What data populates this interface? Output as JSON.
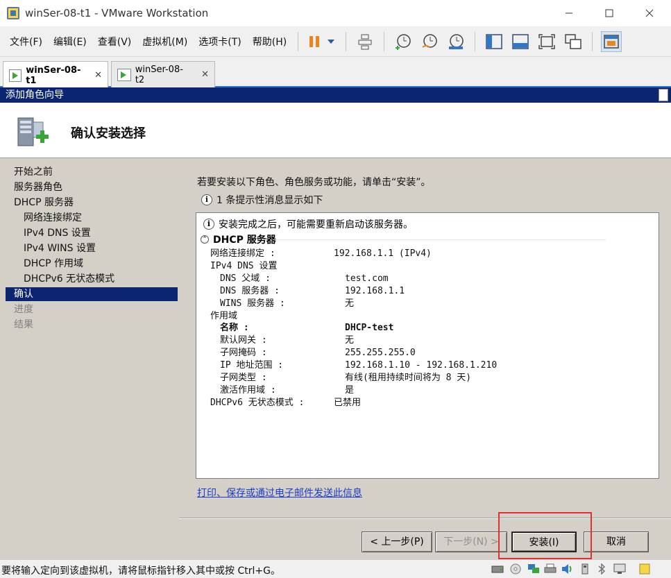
{
  "window": {
    "title": "winSer-08-t1 - VMware Workstation",
    "minimize_icon": "minimize-icon",
    "maximize_icon": "maximize-icon",
    "close_icon": "close-icon"
  },
  "menu": {
    "items": [
      "文件(F)",
      "编辑(E)",
      "查看(V)",
      "虚拟机(M)",
      "选项卡(T)",
      "帮助(H)"
    ]
  },
  "toolbar": {
    "icons": [
      "pause-icon",
      "dropdown-arrow-icon",
      "send-ctrl-alt-del-icon",
      "snapshot-take-icon",
      "snapshot-revert-icon",
      "snapshot-manager-icon",
      "library-view-icon",
      "console-view-icon",
      "fullscreen-icon",
      "unity-icon",
      "thumbnail-view-icon"
    ]
  },
  "tabs": [
    {
      "label": "winSer-08-t1",
      "active": true
    },
    {
      "label": "winSer-08-t2",
      "active": false
    }
  ],
  "wizard": {
    "title": "添加角色向导",
    "heading": "确认安装选择",
    "nav": [
      {
        "label": "开始之前",
        "level": 0,
        "state": "normal"
      },
      {
        "label": "服务器角色",
        "level": 0,
        "state": "normal"
      },
      {
        "label": "DHCP 服务器",
        "level": 0,
        "state": "normal"
      },
      {
        "label": "网络连接绑定",
        "level": 1,
        "state": "normal"
      },
      {
        "label": "IPv4 DNS 设置",
        "level": 1,
        "state": "normal"
      },
      {
        "label": "IPv4 WINS 设置",
        "level": 1,
        "state": "normal"
      },
      {
        "label": "DHCP 作用域",
        "level": 1,
        "state": "normal"
      },
      {
        "label": "DHCPv6 无状态模式",
        "level": 1,
        "state": "normal"
      },
      {
        "label": "确认",
        "level": 0,
        "state": "selected"
      },
      {
        "label": "进度",
        "level": 0,
        "state": "disabled"
      },
      {
        "label": "结果",
        "level": 0,
        "state": "disabled"
      }
    ],
    "intro": "若要安装以下角色、角色服务或功能，请单击“安装”。",
    "hint": "1 条提示性消息显示如下",
    "summary": {
      "restart_note": "安装完成之后，可能需要重新启动该服务器。",
      "section_title": "DHCP 服务器",
      "rows": [
        {
          "label": "网络连接绑定 :",
          "value": "192.168.1.1 (IPv4)",
          "indent": 0,
          "bold": false
        },
        {
          "label": "IPv4 DNS 设置",
          "value": "",
          "indent": 0,
          "bold": false
        },
        {
          "label": "DNS 父域 :",
          "value": "test.com",
          "indent": 1,
          "bold": false
        },
        {
          "label": "DNS 服务器 :",
          "value": "192.168.1.1",
          "indent": 1,
          "bold": false
        },
        {
          "label": "WINS 服务器 :",
          "value": "无",
          "indent": 1,
          "bold": false
        },
        {
          "label": "作用域",
          "value": "",
          "indent": 0,
          "bold": false
        },
        {
          "label": "名称 :",
          "value": "DHCP-test",
          "indent": 1,
          "bold": true
        },
        {
          "label": "默认网关 :",
          "value": "无",
          "indent": 1,
          "bold": false
        },
        {
          "label": "子网掩码 :",
          "value": "255.255.255.0",
          "indent": 1,
          "bold": false
        },
        {
          "label": "IP 地址范围 :",
          "value": "192.168.1.10 - 192.168.1.210",
          "indent": 1,
          "bold": false
        },
        {
          "label": "子网类型 :",
          "value": "有线(租用持续时间将为 8 天)",
          "indent": 1,
          "bold": false
        },
        {
          "label": "激活作用域 :",
          "value": "是",
          "indent": 1,
          "bold": false
        },
        {
          "label": "DHCPv6 无状态模式 :",
          "value": "已禁用",
          "indent": 0,
          "bold": false
        }
      ]
    },
    "link": "打印、保存或通过电子邮件发送此信息",
    "buttons": {
      "prev": "< 上一步(P)",
      "next": "下一步(N) >",
      "install": "安装(I)",
      "cancel": "取消"
    }
  },
  "statusbar": {
    "text": "要将输入定向到该虚拟机，请将鼠标指针移入其中或按 Ctrl+G。",
    "icons": [
      "hard-disk-icon",
      "cd-dvd-icon",
      "network-adapter-icon",
      "printer-icon",
      "sound-icon",
      "usb-icon",
      "bluetooth-icon",
      "display-icon",
      "message-icon"
    ]
  }
}
